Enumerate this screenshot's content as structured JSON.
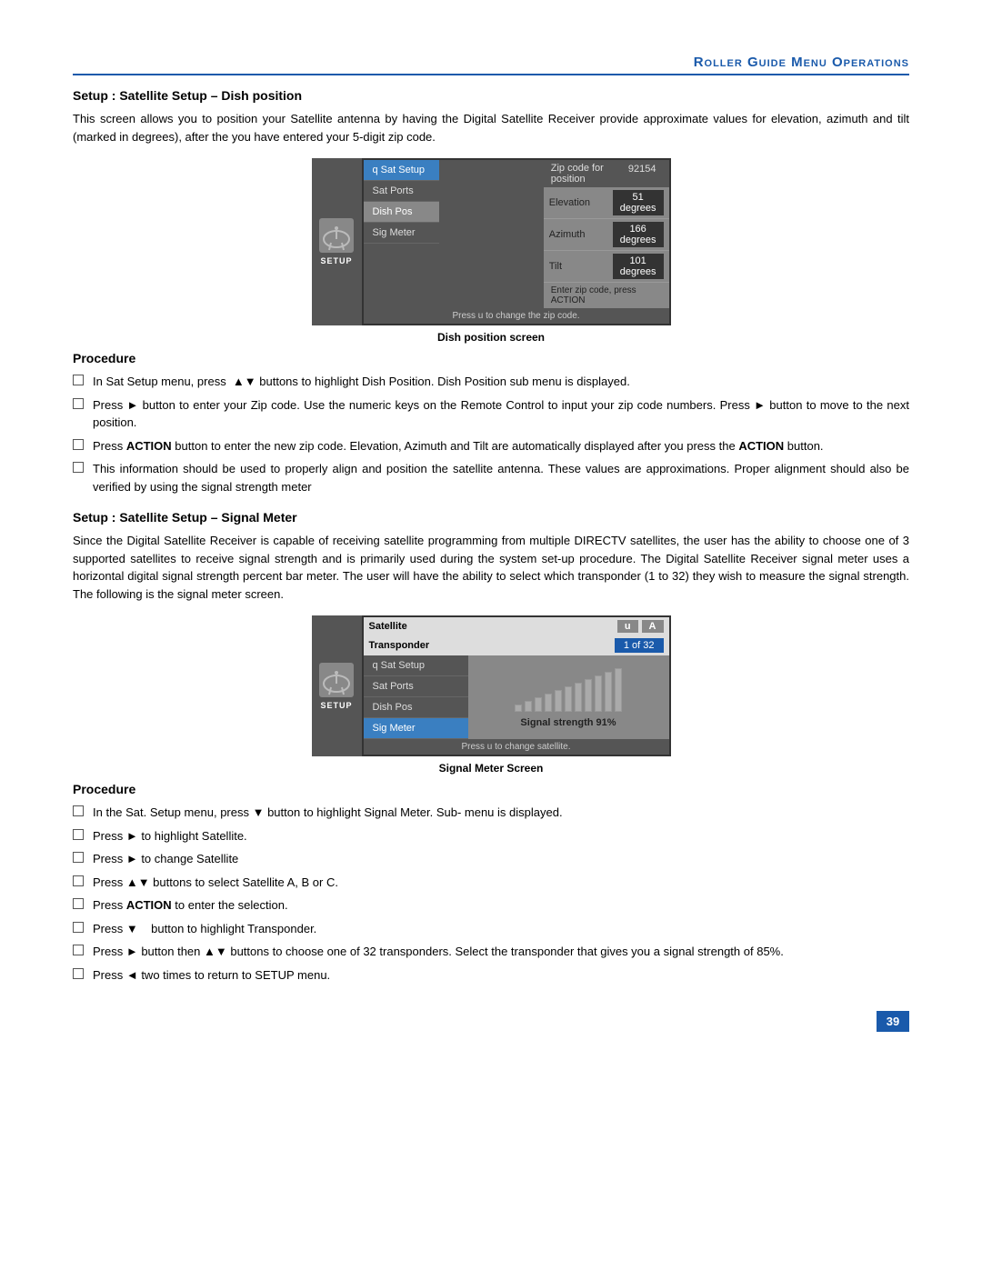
{
  "header": {
    "title": "Roller Guide Menu Operations"
  },
  "section1": {
    "heading": "Setup : Satellite Setup – Dish position",
    "body": "This screen allows you to position your Satellite antenna by having the Digital Satellite Receiver provide approximate values for elevation, azimuth and tilt (marked in degrees), after the you have entered your 5-digit zip code.",
    "screen": {
      "menu_items": [
        {
          "label": "q  Sat Setup",
          "state": "active"
        },
        {
          "label": "Sat Ports",
          "state": "normal"
        },
        {
          "label": "Dish Pos",
          "state": "selected"
        },
        {
          "label": "Sig Meter",
          "state": "normal"
        }
      ],
      "zip_label": "Zip code for position",
      "zip_value": "92154",
      "rows": [
        {
          "label": "Elevation",
          "value": "51 degrees"
        },
        {
          "label": "Azimuth",
          "value": "166 degrees"
        },
        {
          "label": "Tilt",
          "value": "101 degrees"
        }
      ],
      "enter_zip_text": "Enter zip code, press ACTION",
      "footer_text": "Press  u  to change the zip code.",
      "caption": "Dish position screen"
    }
  },
  "procedure1": {
    "heading": "Procedure",
    "items": [
      "In Sat Setup menu, press  ▲▼ buttons to highlight Dish Position. Dish Position sub menu is displayed.",
      "Press ► button to enter your Zip code. Use the numeric keys on the Remote Control to input your zip code numbers. Press ► button to move to the next position.",
      "Press ACTION button to enter the new zip code. Elevation, Azimuth and Tilt are automatically displayed after you press the ACTION button.",
      "This information should be used to properly align and position the satellite antenna. These values are approximations. Proper alignment should also be verified by using the signal strength meter"
    ]
  },
  "section2": {
    "heading": "Setup : Satellite Setup – Signal Meter",
    "body": "Since the Digital Satellite Receiver is capable of receiving satellite programming from multiple DIRECTV satellites, the user has the ability to choose one of 3 supported satellites to receive signal strength and is primarily used during the system set-up procedure. The Digital Satellite Receiver signal meter uses a horizontal digital signal strength percent bar meter. The user will have the ability to select which transponder (1 to 32) they wish to measure the signal strength. The following is the signal meter screen.",
    "screen": {
      "header_label": "Satellite",
      "header_u": "u",
      "header_a": "A",
      "transponder_label": "Transponder",
      "transponder_value": "1 of 32",
      "menu_items": [
        {
          "label": "q  Sat Setup",
          "state": "normal"
        },
        {
          "label": "Sat Ports",
          "state": "normal"
        },
        {
          "label": "Dish Pos",
          "state": "normal"
        },
        {
          "label": "Sig Meter",
          "state": "active"
        }
      ],
      "signal_strength_text": "Signal strength 91%",
      "signal_strength_pct": 91,
      "footer_text": "Press  u  to change satellite.",
      "caption": "Signal Meter Screen"
    }
  },
  "procedure2": {
    "heading": "Procedure",
    "items": [
      "In the Sat. Setup menu, press ▼ button to highlight Signal Meter. Sub- menu is displayed.",
      "Press ► to highlight Satellite.",
      "Press ► to change Satellite",
      "Press ▲▼ buttons to select Satellite A, B or C.",
      "Press ACTION to enter the selection.",
      "Press ▼   button to highlight Transponder.",
      "Press ► button then ▲▼ buttons to choose one of 32 transponders. Select the transponder that gives you a signal strength of 85%.",
      "Press ◄ two times to return to SETUP menu."
    ]
  },
  "page_number": "39"
}
